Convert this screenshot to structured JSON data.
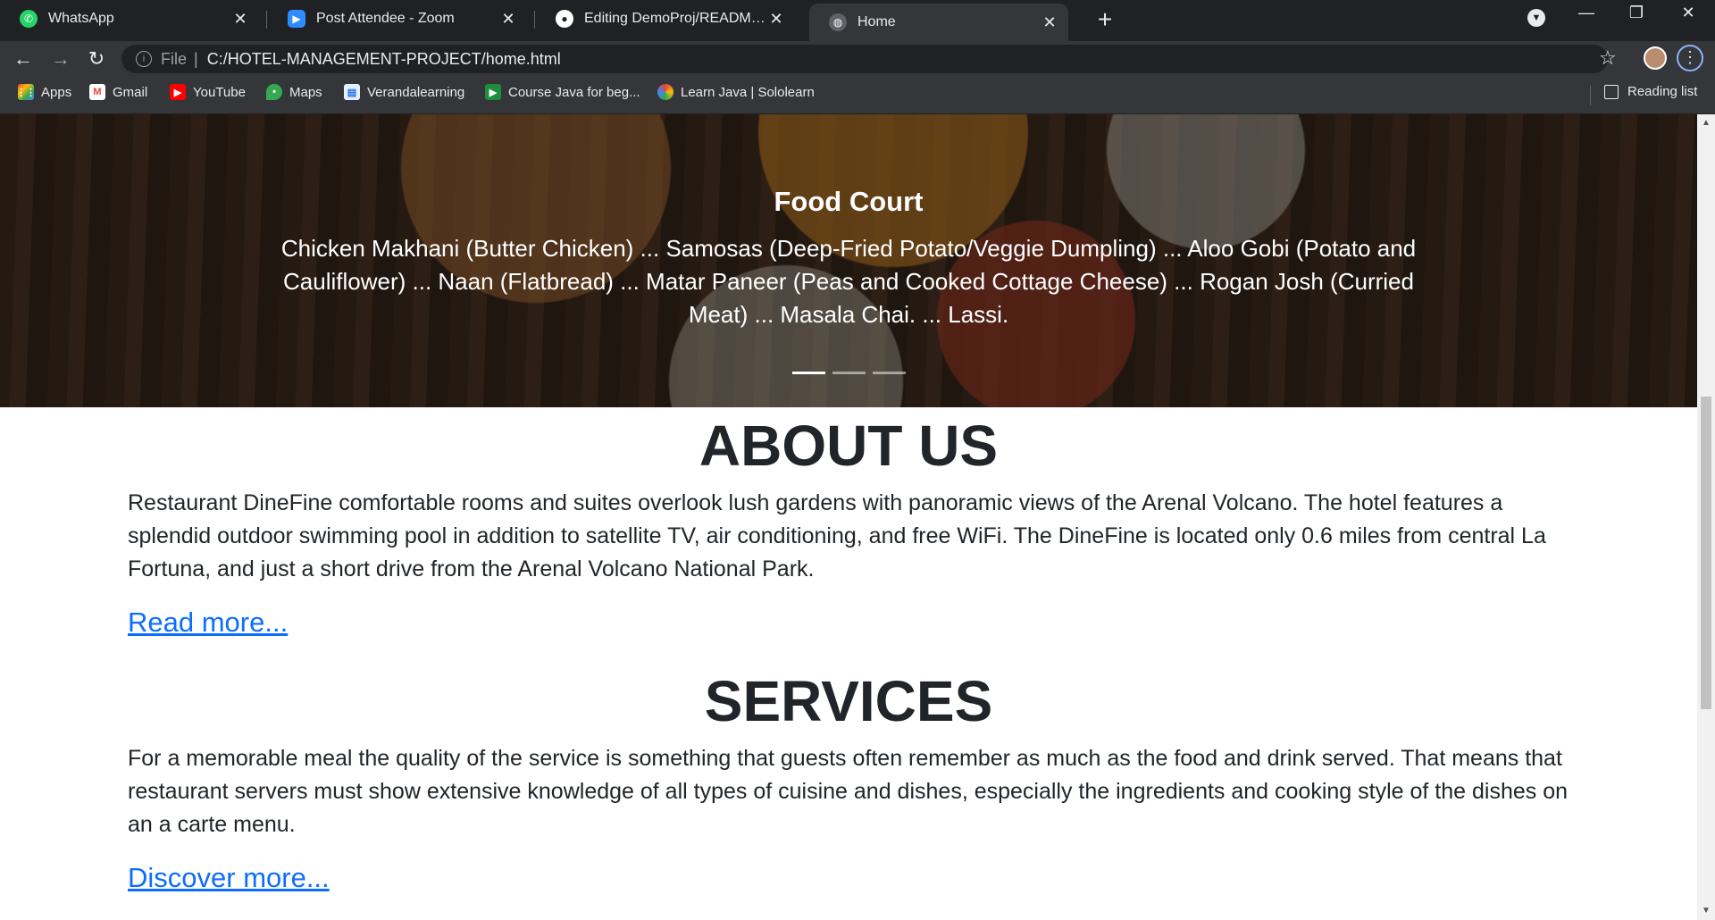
{
  "browser": {
    "tabs": [
      {
        "title": "WhatsApp",
        "icon": "whatsapp-icon",
        "color": "#25d366"
      },
      {
        "title": "Post Attendee - Zoom",
        "icon": "zoom-icon",
        "color": "#2d8cff"
      },
      {
        "title": "Editing DemoProj/README.md at",
        "icon": "github-icon",
        "color": "#ffffff"
      },
      {
        "title": "Home",
        "icon": "globe-icon",
        "color": "#9aa0a6"
      }
    ],
    "address": {
      "scheme": "File",
      "url": "C:/HOTEL-MANAGEMENT-PROJECT/home.html"
    },
    "bookmarks": [
      {
        "label": "Apps",
        "icon": "apps-grid-icon"
      },
      {
        "label": "Gmail",
        "icon": "gmail-icon"
      },
      {
        "label": "YouTube",
        "icon": "youtube-icon"
      },
      {
        "label": "Maps",
        "icon": "maps-icon"
      },
      {
        "label": "Verandalearning",
        "icon": "bookmark-page-icon"
      },
      {
        "label": "Course Java for beg...",
        "icon": "course-icon"
      },
      {
        "label": "Learn Java | Sololearn",
        "icon": "sololearn-icon"
      }
    ],
    "reading_list": "Reading list"
  },
  "hero": {
    "title": "Food Court",
    "text": "Chicken Makhani (Butter Chicken) ... Samosas (Deep-Fried Potato/Veggie Dumpling) ... Aloo Gobi (Potato and Cauliflower) ... Naan (Flatbread) ... Matar Paneer (Peas and Cooked Cottage Cheese) ... Rogan Josh (Curried Meat) ... Masala Chai. ... Lassi.",
    "active_slide": 1,
    "slide_count": 3
  },
  "about": {
    "heading": "ABOUT US",
    "text": "Restaurant DineFine comfortable rooms and suites overlook lush gardens with panoramic views of the Arenal Volcano. The hotel features a splendid outdoor swimming pool in addition to satellite TV, air conditioning, and free WiFi. The DineFine is located only 0.6 miles from central La Fortuna, and just a short drive from the Arenal Volcano National Park.",
    "link": "Read more..."
  },
  "services": {
    "heading": "SERVICES",
    "text": "For a memorable meal the quality of the service is something that guests often remember as much as the food and drink served. That means that restaurant servers must show extensive knowledge of all types of cuisine and dishes, especially the ingredients and cooking style of the dishes on an a carte menu.",
    "link": "Discover more..."
  },
  "colors": {
    "link": "#0d6efd",
    "text": "#212529",
    "chrome_dark": "#202124",
    "chrome_toolbar": "#35363a"
  }
}
